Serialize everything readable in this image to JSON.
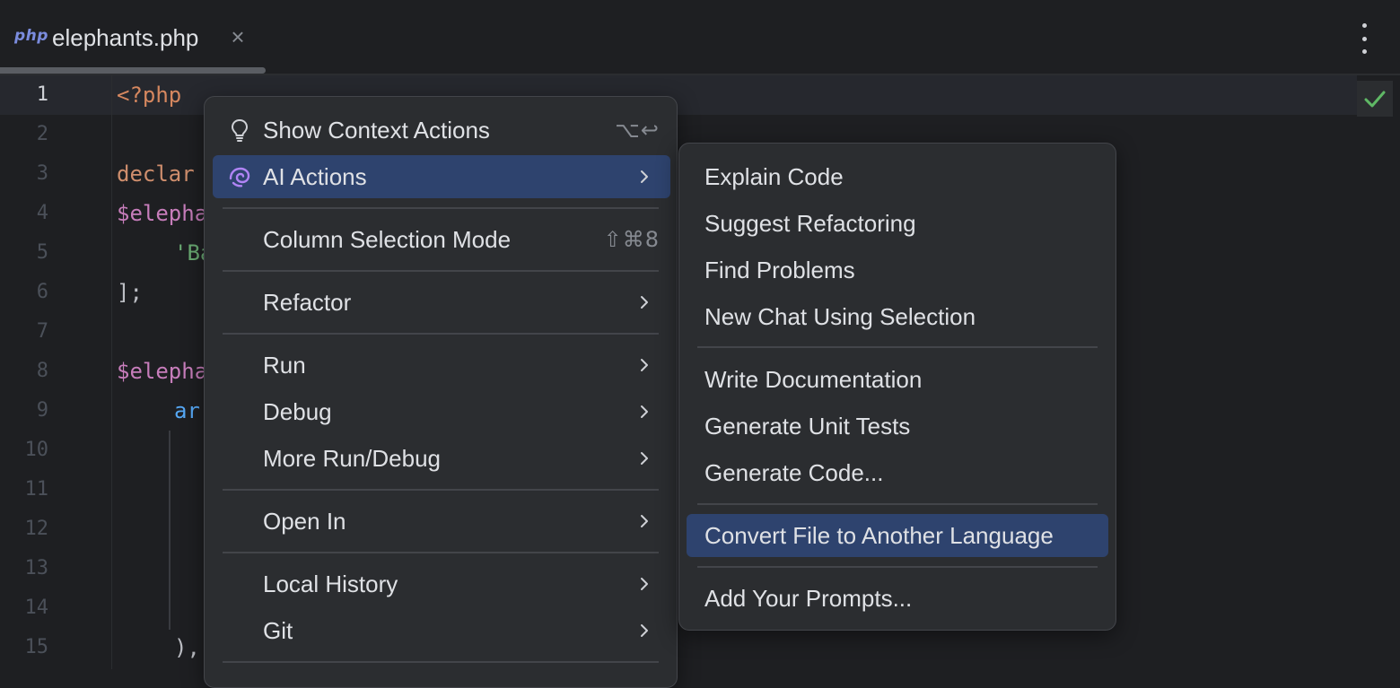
{
  "tab": {
    "icon_text": "php",
    "title": "elephants.php",
    "close": "×"
  },
  "editor": {
    "line_numbers": [
      "1",
      "2",
      "3",
      "4",
      "5",
      "6",
      "7",
      "8",
      "9",
      "10",
      "11",
      "12",
      "13",
      "14",
      "15"
    ],
    "visible_code": {
      "l1": "<?php",
      "l3": "declar",
      "l4": "$elepha",
      "l5": "'Ba",
      "l6": "];",
      "l8": "$elepha",
      "l9": "ar",
      "l15": "),"
    }
  },
  "context_menu": {
    "show_context_actions": {
      "label": "Show Context Actions",
      "shortcut": "⌥↩"
    },
    "ai_actions": {
      "label": "AI Actions"
    },
    "column_selection_mode": {
      "label": "Column Selection Mode",
      "shortcut": "⇧⌘8"
    },
    "refactor": {
      "label": "Refactor"
    },
    "run": {
      "label": "Run"
    },
    "debug": {
      "label": "Debug"
    },
    "more_run_debug": {
      "label": "More Run/Debug"
    },
    "open_in": {
      "label": "Open In"
    },
    "local_history": {
      "label": "Local History"
    },
    "git": {
      "label": "Git"
    }
  },
  "ai_submenu": {
    "explain_code": "Explain Code",
    "suggest_refactoring": "Suggest Refactoring",
    "find_problems": "Find Problems",
    "new_chat": "New Chat Using Selection",
    "write_documentation": "Write Documentation",
    "generate_unit_tests": "Generate Unit Tests",
    "generate_code": "Generate Code...",
    "convert_file": "Convert File to Another Language",
    "add_prompts": "Add Your Prompts..."
  },
  "colors": {
    "background": "#1e1f22",
    "menu_bg": "#2b2d30",
    "selection": "#2e436e",
    "inspection_ok": "#5fb865",
    "ai_icon": "#b084f5"
  }
}
